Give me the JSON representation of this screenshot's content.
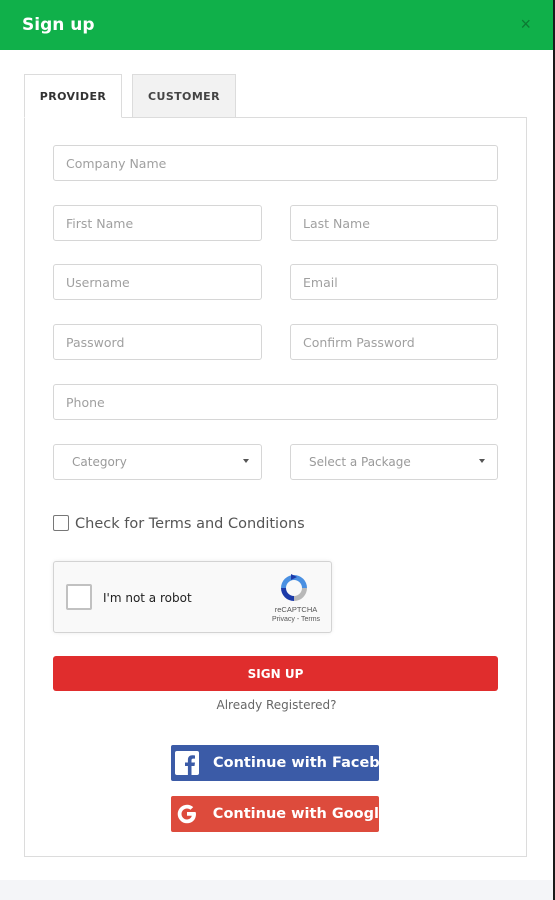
{
  "modal": {
    "title": "Sign up",
    "close_glyph": "×"
  },
  "tabs": [
    {
      "label": "PROVIDER",
      "active": true
    },
    {
      "label": "CUSTOMER",
      "active": false
    }
  ],
  "form": {
    "company_name": {
      "placeholder": "Company Name",
      "value": ""
    },
    "first_name": {
      "placeholder": "First Name",
      "value": ""
    },
    "last_name": {
      "placeholder": "Last Name",
      "value": ""
    },
    "username": {
      "placeholder": "Username",
      "value": ""
    },
    "email": {
      "placeholder": "Email",
      "value": ""
    },
    "password": {
      "placeholder": "Password",
      "value": ""
    },
    "confirm_password": {
      "placeholder": "Confirm Password",
      "value": ""
    },
    "phone": {
      "placeholder": "Phone",
      "value": ""
    },
    "category": {
      "selected": "Category"
    },
    "package": {
      "selected": "Select a Package"
    },
    "terms_label": "Check for Terms and Conditions",
    "terms_checked": false
  },
  "recaptcha": {
    "label": "I'm not a robot",
    "brand": "reCAPTCHA",
    "links": "Privacy - Terms"
  },
  "actions": {
    "signup_label": "SIGN UP",
    "already_registered": "Already Registered?",
    "facebook_label": "Continue with Faceb",
    "google_label": "Continue with Googl"
  },
  "colors": {
    "header": "#10b04a",
    "signup": "#e02d2d",
    "facebook": "#3b5ba7",
    "google": "#dd4b3c"
  },
  "icons": {
    "close": "close-icon",
    "dropdown": "chevron-down-icon",
    "facebook": "facebook-icon",
    "google": "google-icon",
    "recaptcha": "recaptcha-icon"
  }
}
